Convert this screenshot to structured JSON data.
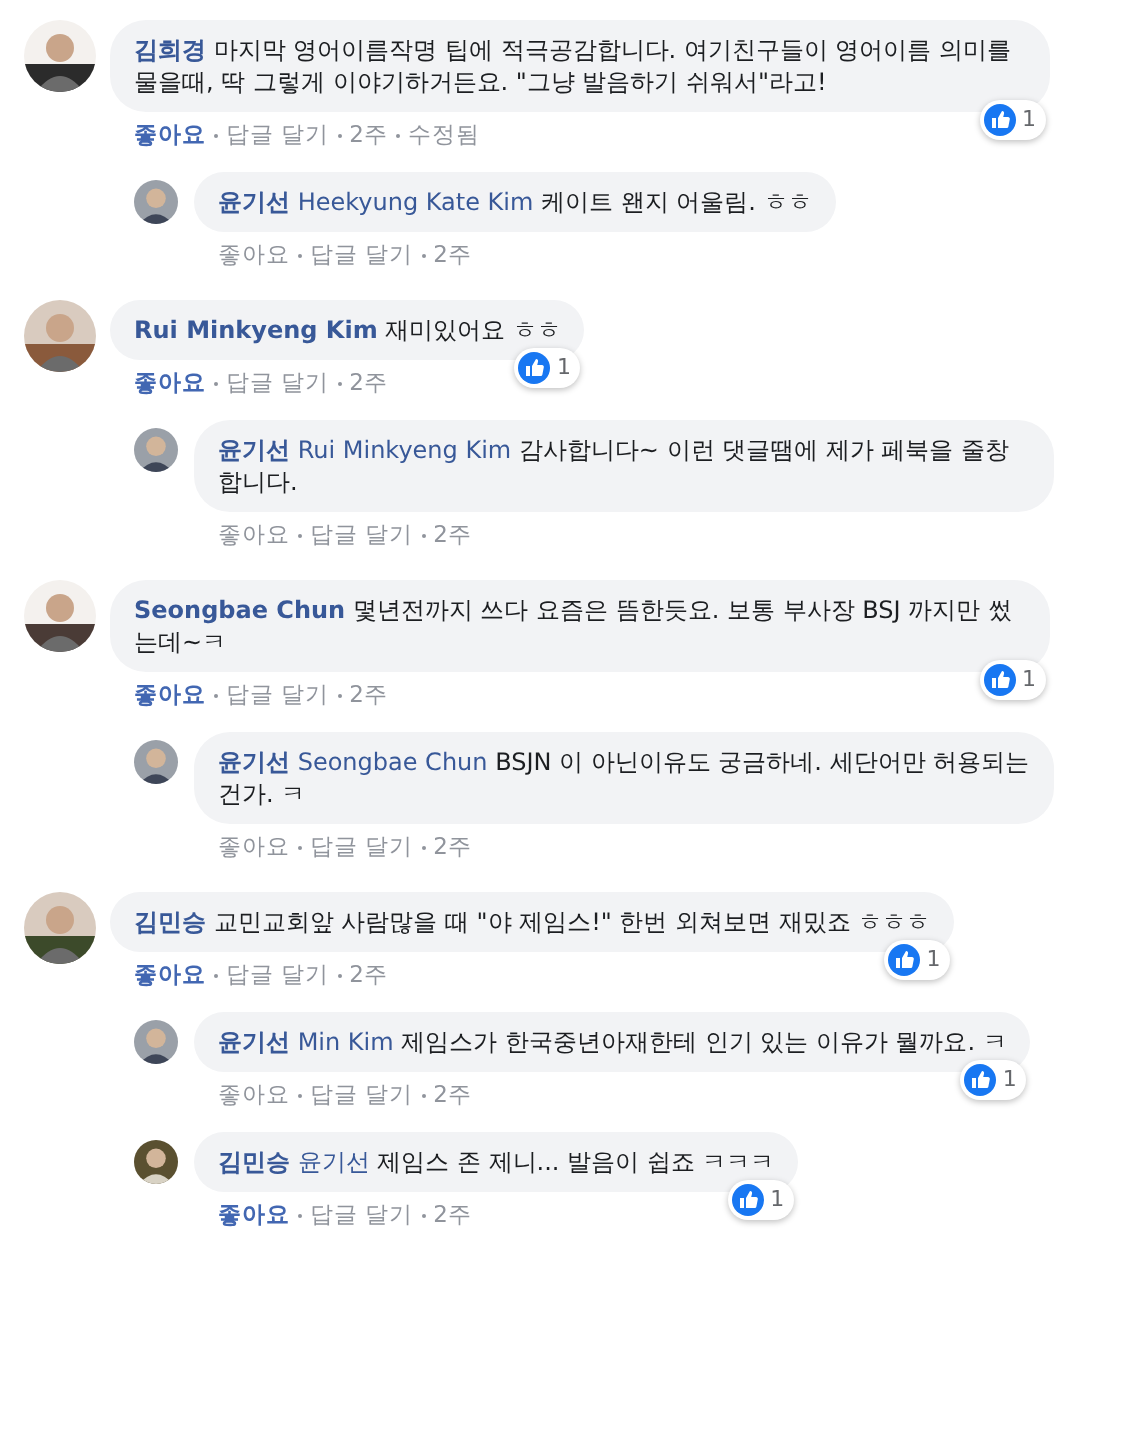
{
  "comments": [
    {
      "author": "김희경",
      "text": "마지막 영어이름작명 팁에 적극공감합니다. 여기친구들이 영어이름 의미를 물을때, 딱 그렇게 이야기하거든요. \"그냥 발음하기 쉬워서\"라고!",
      "liked": true,
      "like_label": "좋아요",
      "reply_label": "답글 달기",
      "time": "2주",
      "edited": "수정됨",
      "reactions": "1",
      "replies": [
        {
          "author": "윤기선",
          "mention": "Heekyung Kate Kim",
          "text": "케이트 왠지 어울림. ㅎㅎ",
          "liked": false,
          "like_label": "좋아요",
          "reply_label": "답글 달기",
          "time": "2주"
        }
      ]
    },
    {
      "author": "Rui Minkyeng Kim",
      "text": "재미있어요 ㅎㅎ",
      "liked": true,
      "like_label": "좋아요",
      "reply_label": "답글 달기",
      "time": "2주",
      "reactions": "1",
      "replies": [
        {
          "author": "윤기선",
          "mention": "Rui Minkyeng Kim",
          "text": "감사합니다~ 이런 댓글땜에 제가 페북을 줄창합니다.",
          "liked": false,
          "like_label": "좋아요",
          "reply_label": "답글 달기",
          "time": "2주"
        }
      ]
    },
    {
      "author": "Seongbae Chun",
      "text": "몇년전까지 쓰다 요즘은 뜸한듯요. 보통 부사장 BSJ 까지만 썼는데~ㅋ",
      "liked": true,
      "like_label": "좋아요",
      "reply_label": "답글 달기",
      "time": "2주",
      "reactions": "1",
      "replies": [
        {
          "author": "윤기선",
          "mention": "Seongbae Chun",
          "text": "BSJN 이 아닌이유도 궁금하네. 세단어만 허용되는건가. ㅋ",
          "liked": false,
          "like_label": "좋아요",
          "reply_label": "답글 달기",
          "time": "2주"
        }
      ]
    },
    {
      "author": "김민승",
      "text": "교민교회앞 사람많을 때 \"야 제임스!\" 한번 외쳐보면 재밌죠 ㅎㅎㅎ",
      "liked": true,
      "like_label": "좋아요",
      "reply_label": "답글 달기",
      "time": "2주",
      "reactions": "1",
      "replies": [
        {
          "author": "윤기선",
          "mention": "Min Kim",
          "text": "제임스가 한국중년아재한테 인기 있는 이유가 뭘까요. ㅋ",
          "liked": false,
          "like_label": "좋아요",
          "reply_label": "답글 달기",
          "time": "2주",
          "reactions": "1"
        },
        {
          "author": "김민승",
          "mention": "윤기선",
          "text": "제임스 존 제니... 발음이 쉽죠 ㅋㅋㅋ",
          "liked": true,
          "like_label": "좋아요",
          "reply_label": "답글 달기",
          "time": "2주",
          "reactions": "1"
        }
      ]
    }
  ]
}
